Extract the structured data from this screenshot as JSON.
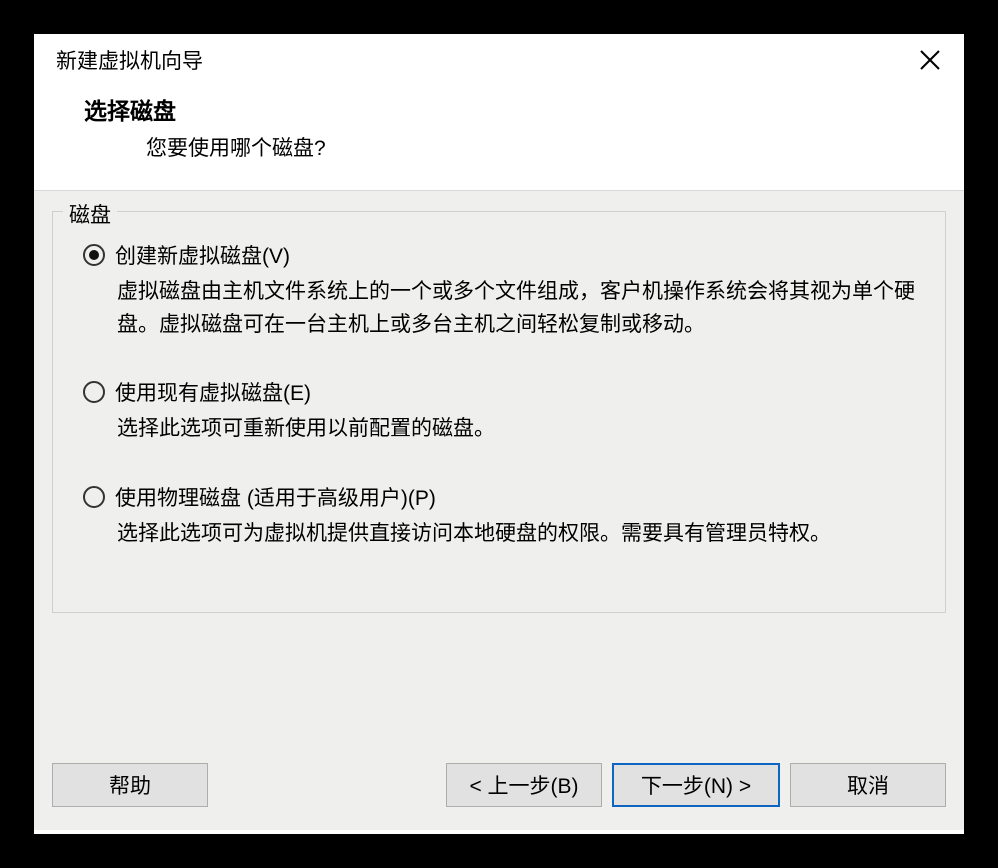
{
  "window": {
    "title": "新建虚拟机向导"
  },
  "header": {
    "title": "选择磁盘",
    "subtitle": "您要使用哪个磁盘?"
  },
  "group": {
    "legend": "磁盘",
    "options": [
      {
        "label": "创建新虚拟磁盘(V)",
        "desc": "虚拟磁盘由主机文件系统上的一个或多个文件组成，客户机操作系统会将其视为单个硬盘。虚拟磁盘可在一台主机上或多台主机之间轻松复制或移动。",
        "checked": true
      },
      {
        "label": "使用现有虚拟磁盘(E)",
        "desc": "选择此选项可重新使用以前配置的磁盘。",
        "checked": false
      },
      {
        "label": "使用物理磁盘 (适用于高级用户)(P)",
        "desc": "选择此选项可为虚拟机提供直接访问本地硬盘的权限。需要具有管理员特权。",
        "checked": false
      }
    ]
  },
  "buttons": {
    "help": "帮助",
    "back": "< 上一步(B)",
    "next": "下一步(N) >",
    "cancel": "取消"
  }
}
